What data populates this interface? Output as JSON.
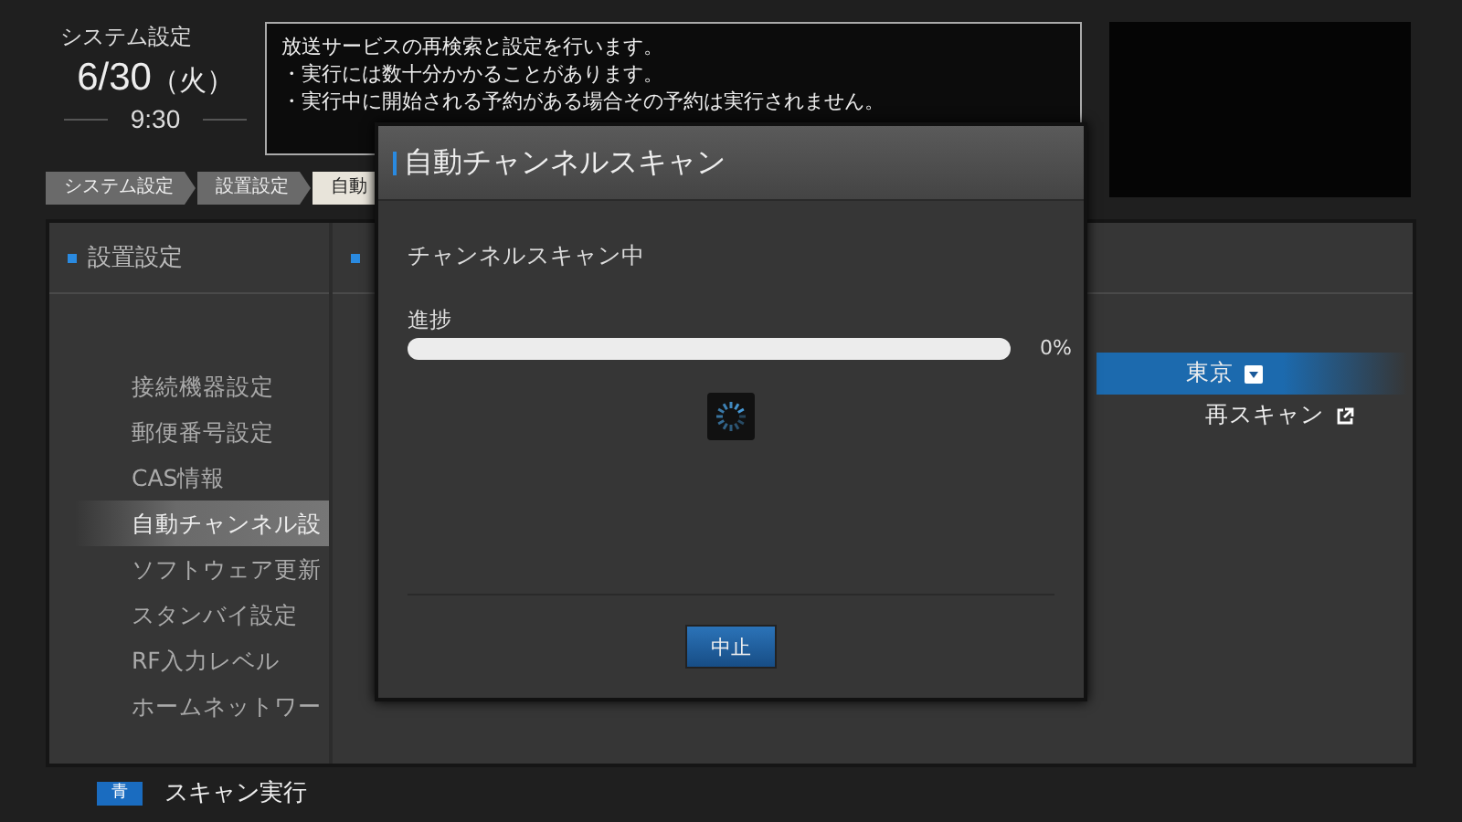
{
  "header": {
    "title": "システム設定",
    "date": "6/30",
    "weekday": "（火）",
    "time": "9:30"
  },
  "description": [
    "放送サービスの再検索と設定を行います。",
    "・実行には数十分かかることがあります。",
    "・実行中に開始される予約がある場合その予約は実行されません。"
  ],
  "breadcrumb": [
    {
      "label": "システム設定",
      "selected": false
    },
    {
      "label": "設置設定",
      "selected": false
    },
    {
      "label": "自動",
      "selected": true
    }
  ],
  "sidebar": {
    "title": "設置設定",
    "items": [
      {
        "label": "接続機器設定",
        "selected": false
      },
      {
        "label": "郵便番号設定",
        "selected": false
      },
      {
        "label": "CAS情報",
        "selected": false
      },
      {
        "label": "自動チャンネル設",
        "selected": true
      },
      {
        "label": "ソフトウェア更新",
        "selected": false
      },
      {
        "label": "スタンバイ設定",
        "selected": false
      },
      {
        "label": "RF入力レベル",
        "selected": false
      },
      {
        "label": "ホームネットワー",
        "selected": false
      }
    ]
  },
  "settings": {
    "rows": [
      {
        "kind": "dropdown",
        "label": "東京",
        "selected": true
      },
      {
        "kind": "action",
        "label": "再スキャン",
        "selected": false
      }
    ]
  },
  "dialog": {
    "title": "自動チャンネルスキャン",
    "status": "チャンネルスキャン中",
    "progress": {
      "label": "進捗",
      "level": 0,
      "reading": "0%"
    },
    "buttons": [
      {
        "label": "中止",
        "selected": true
      }
    ]
  },
  "footer": {
    "keys": [
      {
        "key": "青",
        "color": "#1a6cc0",
        "label": "スキャン実行"
      }
    ]
  }
}
